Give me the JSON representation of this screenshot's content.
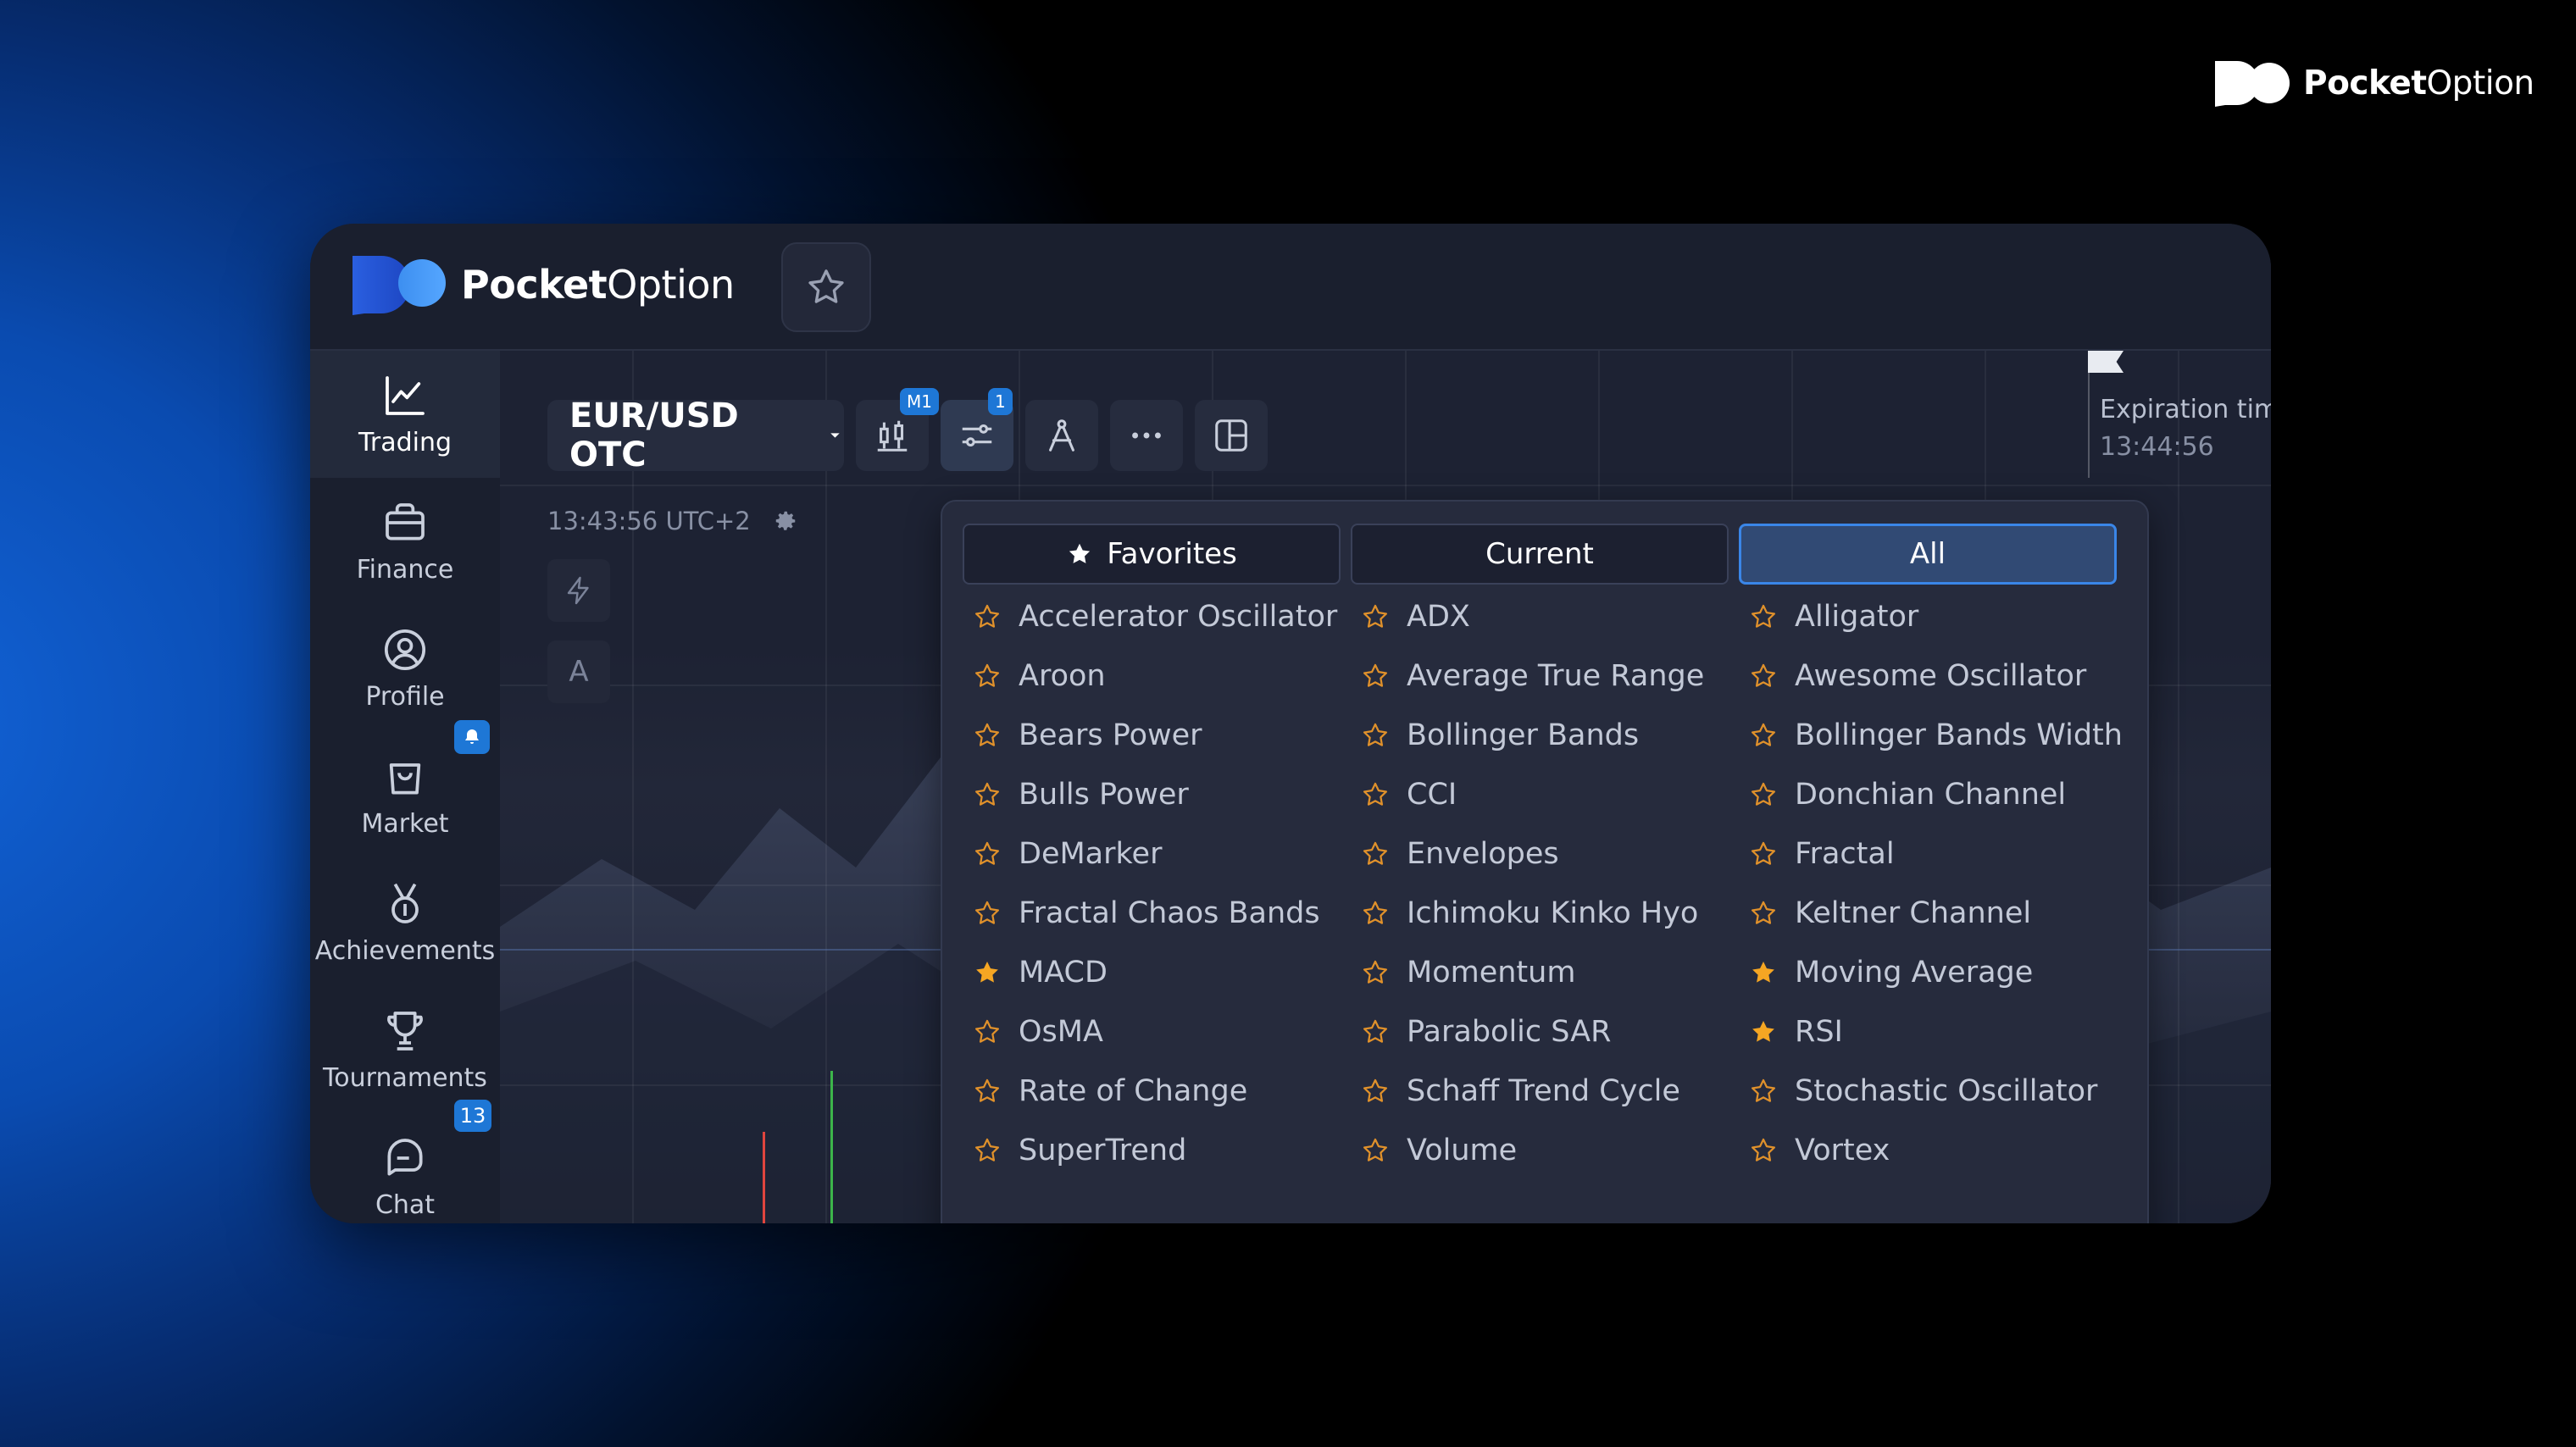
{
  "brand": {
    "name_bold": "Pocket",
    "name_light": "Option"
  },
  "app": {
    "logo_bold": "Pocket",
    "logo_light": "Option"
  },
  "sidebar": {
    "items": [
      {
        "label": "Trading",
        "icon": "chart-line-icon",
        "active": true
      },
      {
        "label": "Finance",
        "icon": "briefcase-icon"
      },
      {
        "label": "Profile",
        "icon": "user-circle-icon"
      },
      {
        "label": "Market",
        "icon": "shopping-bag-icon"
      },
      {
        "label": "Achievements",
        "icon": "medal-icon"
      },
      {
        "label": "Tournaments",
        "icon": "trophy-icon"
      },
      {
        "label": "Chat",
        "icon": "chat-icon"
      }
    ],
    "chat_badge": "13"
  },
  "toolbar": {
    "pair": "EUR/USD OTC",
    "timeframe_badge": "M1",
    "indicators_badge": "1"
  },
  "chart": {
    "clock": "13:43:56 UTC+2",
    "expiration_label": "Expiration time",
    "expiration_time": "13:44:56",
    "side_tool_a": "A"
  },
  "panel": {
    "tabs": [
      "Favorites",
      "Current",
      "All"
    ],
    "selected_tab": "All",
    "indicators": [
      [
        "Accelerator Oscillator",
        "Aroon",
        "Bears Power",
        "Bulls Power",
        "DeMarker",
        "Fractal Chaos Bands",
        "MACD",
        "OsMA",
        "Rate of Change",
        "SuperTrend"
      ],
      [
        "ADX",
        "Average True Range",
        "Bollinger Bands",
        "CCI",
        "Envelopes",
        "Ichimoku Kinko Hyo",
        "Momentum",
        "Parabolic SAR",
        "Schaff Trend Cycle",
        "Volume"
      ],
      [
        "Alligator",
        "Awesome Oscillator",
        "Bollinger Bands Width",
        "Donchian Channel",
        "Fractal",
        "Keltner Channel",
        "Moving Average",
        "RSI",
        "Stochastic Oscillator",
        "Vortex"
      ]
    ],
    "favorites": [
      "MACD",
      "Moving Average",
      "RSI"
    ]
  },
  "colors": {
    "accent": "#1e77d6",
    "star_fav": "#f5a623",
    "star_outline": "#e0912b",
    "panel_bg": "#262b3d"
  }
}
